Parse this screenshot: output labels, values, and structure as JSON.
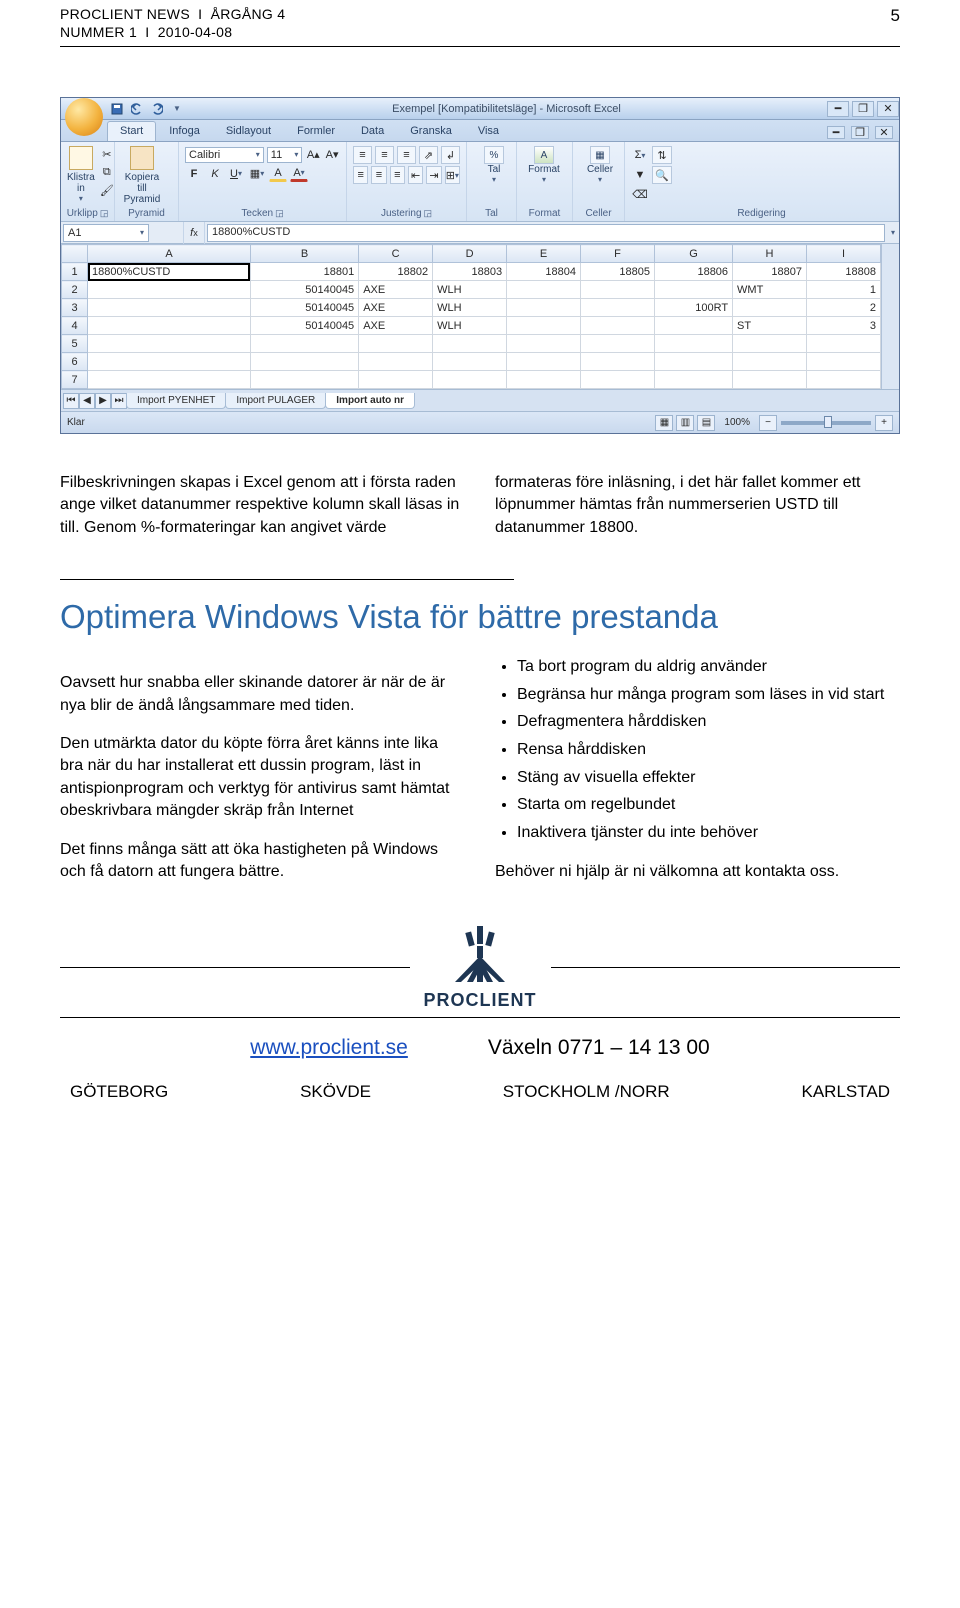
{
  "header": {
    "title": "PROCLIENT NEWS",
    "sep": "I",
    "year": "ÅRGÅNG 4",
    "issue": "NUMMER 1",
    "date": "2010-04-08",
    "page": "5"
  },
  "excel": {
    "title": "Exempel  [Kompatibilitetsläge] - Microsoft Excel",
    "tabs": [
      "Start",
      "Infoga",
      "Sidlayout",
      "Formler",
      "Data",
      "Granska",
      "Visa"
    ],
    "name_box": "A1",
    "formula_bar": "18800%CUSTD",
    "groups": {
      "urklipp": {
        "label": "Urklipp",
        "button": "Klistra\nin"
      },
      "pyramid": {
        "label": "Pyramid",
        "button": "Kopiera till\nPyramid"
      },
      "tecken": {
        "label": "Tecken",
        "font": "Calibri",
        "size": "11"
      },
      "justering": {
        "label": "Justering"
      },
      "tal_group": {
        "label": "Tal",
        "button": "Tal"
      },
      "format": {
        "label": "Format",
        "button": "Format"
      },
      "celler": {
        "label": "Celler",
        "button": "Celler"
      },
      "redigering": {
        "label": "Redigering"
      }
    },
    "columns": [
      "A",
      "B",
      "C",
      "D",
      "E",
      "F",
      "G",
      "H",
      "I"
    ],
    "rows": [
      [
        "18800%CUSTD",
        "18801",
        "18802",
        "18803",
        "18804",
        "18805",
        "18806",
        "18807",
        "18808"
      ],
      [
        "",
        "50140045",
        "AXE",
        "WLH",
        "",
        "",
        "",
        "WMT",
        "1"
      ],
      [
        "",
        "50140045",
        "AXE",
        "WLH",
        "",
        "",
        "100RT",
        "",
        "2"
      ],
      [
        "",
        "50140045",
        "AXE",
        "WLH",
        "",
        "",
        "",
        "ST",
        "3"
      ],
      [
        "",
        "",
        "",
        "",
        "",
        "",
        "",
        "",
        ""
      ],
      [
        "",
        "",
        "",
        "",
        "",
        "",
        "",
        "",
        ""
      ],
      [
        "",
        "",
        "",
        "",
        "",
        "",
        "",
        "",
        ""
      ]
    ],
    "sheets": [
      "Import PYENHET",
      "Import PULAGER",
      "Import auto nr"
    ],
    "status": {
      "ready": "Klar",
      "zoom": "100%"
    }
  },
  "body": {
    "col1": "Filbeskrivningen skapas i Excel genom att i första raden ange vilket datanummer respektive kolumn skall läsas in till. Genom %-formateringar kan angivet värde",
    "col2": "formateras före inläsning, i det här fallet kommer ett löpnummer hämtas från nummerserien USTD till datanummer 18800."
  },
  "section_title": "Optimera Windows Vista för bättre prestanda",
  "article": {
    "p1": "Oavsett hur snabba eller skinande datorer är när de är nya blir de ändå långsammare med tiden.",
    "p2": "Den utmärkta dator du köpte förra året känns inte lika bra när du har installerat ett dussin program, läst in antispionprogram och verktyg för antivirus samt hämtat obeskrivbara mängder skräp från Internet",
    "p3": "Det finns många sätt att öka hastigheten på Windows och få datorn att fungera bättre.",
    "tips": [
      "Ta bort program du aldrig använder",
      "Begränsa hur många program som läses in vid start",
      "Defragmentera hårddisken",
      "Rensa hårddisken",
      "Stäng av visuella effekter",
      "Starta om regelbundet",
      "Inaktivera tjänster du inte behöver"
    ],
    "p4": "Behöver ni hjälp är ni välkomna att kontakta oss."
  },
  "logo_text": "PROCLIENT",
  "footer": {
    "url": "www.proclient.se",
    "switchboard": "Växeln  0771 – 14 13 00",
    "cities": [
      "GÖTEBORG",
      "SKÖVDE",
      "STOCKHOLM /NORR",
      "KARLSTAD"
    ]
  }
}
